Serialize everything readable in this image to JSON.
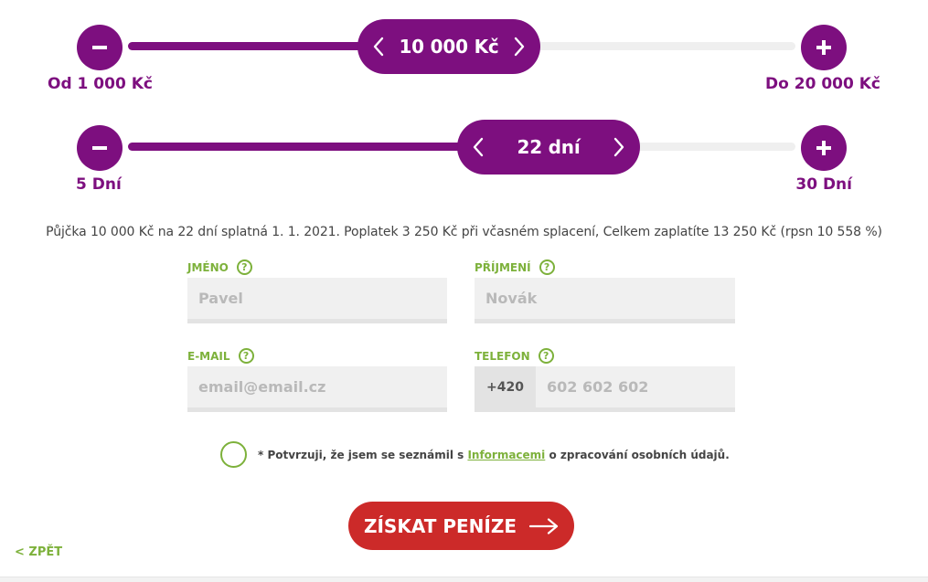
{
  "amount_slider": {
    "value": "10 000 Kč",
    "min_label": "Od 1 000 Kč",
    "max_label": "Do 20 000 Kč",
    "min": 1000,
    "max": 20000,
    "current": 10000
  },
  "days_slider": {
    "value": "22 dní",
    "min_label": "5 Dní",
    "max_label": "30 Dní",
    "min": 5,
    "max": 30,
    "current": 22
  },
  "summary": "Půjčka 10 000 Kč na 22 dní splatná 1. 1. 2021. Poplatek 3 250 Kč při včasném splacení, Celkem zaplatíte 13 250 Kč (rpsn 10 558 %)",
  "form": {
    "first_name": {
      "label": "JMÉNO",
      "placeholder": "Pavel"
    },
    "last_name": {
      "label": "PŘÍJMENÍ",
      "placeholder": "Novák"
    },
    "email": {
      "label": "E-MAIL",
      "placeholder": "email@email.cz"
    },
    "phone": {
      "label": "TELEFON",
      "prefix": "+420",
      "placeholder": "602 602 602"
    },
    "help_glyph": "?"
  },
  "consent": {
    "before": "* Potvrzuji, že jsem se seznámil s ",
    "link": "Informacemi",
    "after": " o zpracování osobních údajů."
  },
  "cta_label": "ZÍSKAT PENÍZE",
  "back_label": "< ZPĚT",
  "colors": {
    "brand": "#7d0f7f",
    "accent": "#7db13b",
    "cta": "#cc2a29"
  },
  "icons": [
    "minus-icon",
    "plus-icon",
    "chevron-left-icon",
    "chevron-right-icon",
    "help-icon",
    "arrow-right-icon"
  ]
}
